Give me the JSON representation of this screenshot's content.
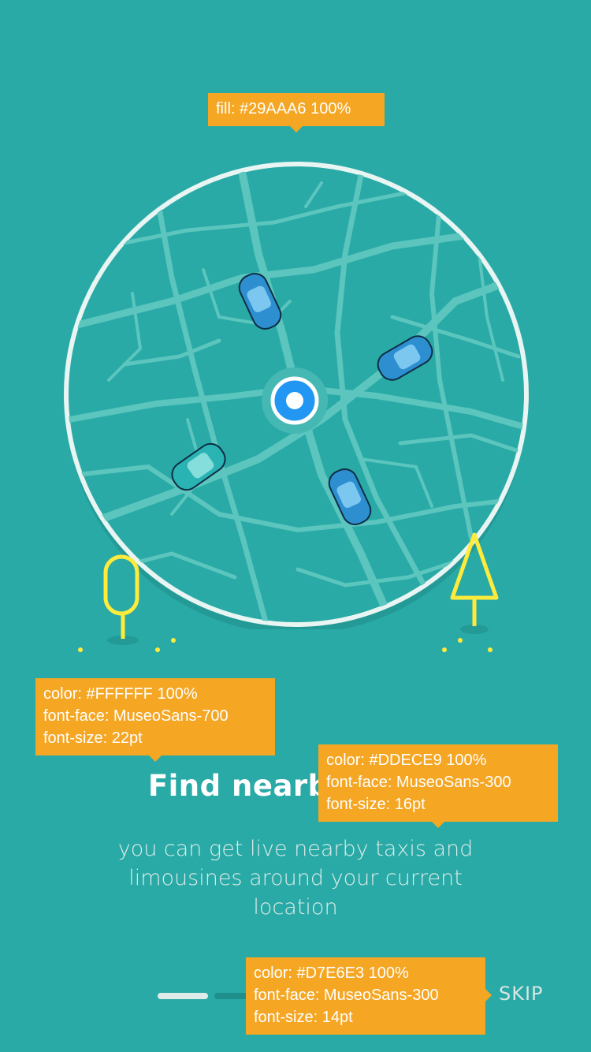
{
  "map": {
    "circle_border_color": "#E8F5F3",
    "map_fill": "#29AAA6",
    "road_color": "#5BC5BE",
    "location_pin_color": "#2196F3",
    "tree_color": "#FFEB3B",
    "cars": [
      {
        "name": "taxi",
        "color": "#2D8FD0"
      },
      {
        "name": "taxi",
        "color": "#2D8FD0"
      },
      {
        "name": "taxi",
        "color": "#2D8FD0"
      },
      {
        "name": "taxi",
        "color": "#2AB3B3"
      }
    ]
  },
  "onboarding": {
    "title": "Find nearby Taxis",
    "subtitle": "you can get live nearby taxis and limousines around your current location",
    "skip_label": "SKIP",
    "page_count": 2,
    "current_page": 1
  },
  "annotations": {
    "map_fill": [
      "fill: #29AAA6 100%"
    ],
    "title_spec": [
      "color: #FFFFFF 100%",
      "font-face: MuseoSans-700",
      "font-size: 22pt"
    ],
    "subtitle_spec": [
      "color: #DDECE9 100%",
      "font-face: MuseoSans-300",
      "font-size: 16pt"
    ],
    "skip_spec": [
      "color: #D7E6E3 100%",
      "font-face: MuseoSans-300",
      "font-size: 14pt"
    ]
  }
}
